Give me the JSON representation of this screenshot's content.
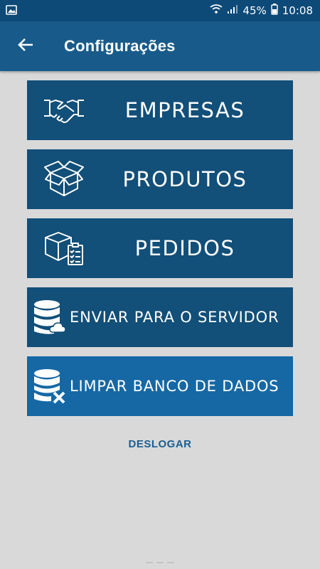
{
  "status_bar": {
    "battery_percent": "45%",
    "time": "10:08",
    "icons": [
      "image-icon",
      "wifi-icon",
      "signal-icon",
      "battery-icon"
    ]
  },
  "app_bar": {
    "title": "Configurações",
    "back_icon": "arrow-left-icon"
  },
  "menu": [
    {
      "label": "EMPRESAS",
      "icon": "handshake-icon",
      "style": "dark"
    },
    {
      "label": "PRODUTOS",
      "icon": "box-icon",
      "style": "dark"
    },
    {
      "label": "PEDIDOS",
      "icon": "box-checklist-icon",
      "style": "dark"
    },
    {
      "label": "ENVIAR PARA O SERVIDOR",
      "icon": "database-upload-icon",
      "style": "dark"
    },
    {
      "label": "LIMPAR BANCO DE DADOS",
      "icon": "database-delete-icon",
      "style": "light"
    }
  ],
  "logout_label": "DESLOGAR",
  "colors": {
    "status_bar": "#0d4a78",
    "app_bar": "#185b8b",
    "button_dark": "#124f79",
    "button_light": "#1668a5",
    "background": "#d9d9d9",
    "link": "#1c5f90"
  }
}
